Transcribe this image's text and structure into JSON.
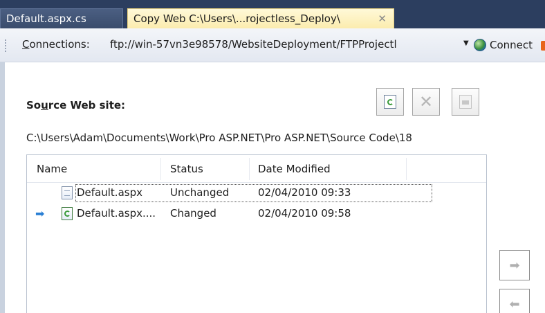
{
  "tabs": [
    {
      "label": "Default.aspx.cs",
      "active": false
    },
    {
      "label": "Copy Web C:\\Users\\...rojectless_Deploy\\",
      "active": true
    }
  ],
  "tab_close_glyph": "✕",
  "toolbar": {
    "connections_label_prefix": "",
    "connections_hotkey": "C",
    "connections_label_rest": "onnections:",
    "connection_url": "ftp://win-57vn3e98578/WebsiteDeployment/FTPProjectl",
    "connect_label": "Connect"
  },
  "source": {
    "label_pre": "So",
    "label_hotkey": "u",
    "label_post": "rce Web site:",
    "path": "C:\\Users\\Adam\\Documents\\Work\\Pro ASP.NET\\Pro ASP.NET\\Source Code\\18"
  },
  "file_list": {
    "columns": [
      "Name",
      "Status",
      "Date Modified"
    ],
    "rows": [
      {
        "name": "Default.aspx",
        "status": "Unchanged",
        "date_modified": "02/04/2010 09:33",
        "icon": "aspx-file-icon",
        "marker": ""
      },
      {
        "name": "Default.aspx....",
        "status": "Changed",
        "date_modified": "02/04/2010 09:58",
        "icon": "aspx-changed-file-icon",
        "marker": "➡"
      }
    ]
  },
  "buttons": {
    "refresh": "refresh-icon",
    "delete": "delete-icon",
    "edit": "edit-icon",
    "copy_right": "➡",
    "copy_left": "⬅"
  },
  "colors": {
    "tab_strip": "#2c3e5f",
    "active_tab": "#fbecae",
    "arrow_blue": "#2a7fd4"
  }
}
